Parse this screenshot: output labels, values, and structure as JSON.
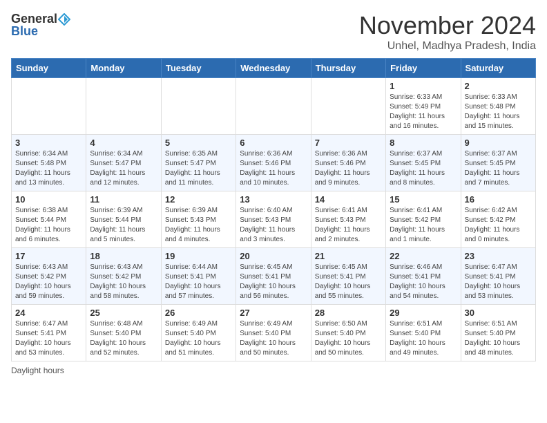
{
  "logo": {
    "general": "General",
    "blue": "Blue"
  },
  "title": "November 2024",
  "subtitle": "Unhel, Madhya Pradesh, India",
  "days_of_week": [
    "Sunday",
    "Monday",
    "Tuesday",
    "Wednesday",
    "Thursday",
    "Friday",
    "Saturday"
  ],
  "footer": "Daylight hours",
  "weeks": [
    [
      {
        "day": "",
        "info": ""
      },
      {
        "day": "",
        "info": ""
      },
      {
        "day": "",
        "info": ""
      },
      {
        "day": "",
        "info": ""
      },
      {
        "day": "",
        "info": ""
      },
      {
        "day": "1",
        "info": "Sunrise: 6:33 AM\nSunset: 5:49 PM\nDaylight: 11 hours and 16 minutes."
      },
      {
        "day": "2",
        "info": "Sunrise: 6:33 AM\nSunset: 5:48 PM\nDaylight: 11 hours and 15 minutes."
      }
    ],
    [
      {
        "day": "3",
        "info": "Sunrise: 6:34 AM\nSunset: 5:48 PM\nDaylight: 11 hours and 13 minutes."
      },
      {
        "day": "4",
        "info": "Sunrise: 6:34 AM\nSunset: 5:47 PM\nDaylight: 11 hours and 12 minutes."
      },
      {
        "day": "5",
        "info": "Sunrise: 6:35 AM\nSunset: 5:47 PM\nDaylight: 11 hours and 11 minutes."
      },
      {
        "day": "6",
        "info": "Sunrise: 6:36 AM\nSunset: 5:46 PM\nDaylight: 11 hours and 10 minutes."
      },
      {
        "day": "7",
        "info": "Sunrise: 6:36 AM\nSunset: 5:46 PM\nDaylight: 11 hours and 9 minutes."
      },
      {
        "day": "8",
        "info": "Sunrise: 6:37 AM\nSunset: 5:45 PM\nDaylight: 11 hours and 8 minutes."
      },
      {
        "day": "9",
        "info": "Sunrise: 6:37 AM\nSunset: 5:45 PM\nDaylight: 11 hours and 7 minutes."
      }
    ],
    [
      {
        "day": "10",
        "info": "Sunrise: 6:38 AM\nSunset: 5:44 PM\nDaylight: 11 hours and 6 minutes."
      },
      {
        "day": "11",
        "info": "Sunrise: 6:39 AM\nSunset: 5:44 PM\nDaylight: 11 hours and 5 minutes."
      },
      {
        "day": "12",
        "info": "Sunrise: 6:39 AM\nSunset: 5:43 PM\nDaylight: 11 hours and 4 minutes."
      },
      {
        "day": "13",
        "info": "Sunrise: 6:40 AM\nSunset: 5:43 PM\nDaylight: 11 hours and 3 minutes."
      },
      {
        "day": "14",
        "info": "Sunrise: 6:41 AM\nSunset: 5:43 PM\nDaylight: 11 hours and 2 minutes."
      },
      {
        "day": "15",
        "info": "Sunrise: 6:41 AM\nSunset: 5:42 PM\nDaylight: 11 hours and 1 minute."
      },
      {
        "day": "16",
        "info": "Sunrise: 6:42 AM\nSunset: 5:42 PM\nDaylight: 11 hours and 0 minutes."
      }
    ],
    [
      {
        "day": "17",
        "info": "Sunrise: 6:43 AM\nSunset: 5:42 PM\nDaylight: 10 hours and 59 minutes."
      },
      {
        "day": "18",
        "info": "Sunrise: 6:43 AM\nSunset: 5:42 PM\nDaylight: 10 hours and 58 minutes."
      },
      {
        "day": "19",
        "info": "Sunrise: 6:44 AM\nSunset: 5:41 PM\nDaylight: 10 hours and 57 minutes."
      },
      {
        "day": "20",
        "info": "Sunrise: 6:45 AM\nSunset: 5:41 PM\nDaylight: 10 hours and 56 minutes."
      },
      {
        "day": "21",
        "info": "Sunrise: 6:45 AM\nSunset: 5:41 PM\nDaylight: 10 hours and 55 minutes."
      },
      {
        "day": "22",
        "info": "Sunrise: 6:46 AM\nSunset: 5:41 PM\nDaylight: 10 hours and 54 minutes."
      },
      {
        "day": "23",
        "info": "Sunrise: 6:47 AM\nSunset: 5:41 PM\nDaylight: 10 hours and 53 minutes."
      }
    ],
    [
      {
        "day": "24",
        "info": "Sunrise: 6:47 AM\nSunset: 5:41 PM\nDaylight: 10 hours and 53 minutes."
      },
      {
        "day": "25",
        "info": "Sunrise: 6:48 AM\nSunset: 5:40 PM\nDaylight: 10 hours and 52 minutes."
      },
      {
        "day": "26",
        "info": "Sunrise: 6:49 AM\nSunset: 5:40 PM\nDaylight: 10 hours and 51 minutes."
      },
      {
        "day": "27",
        "info": "Sunrise: 6:49 AM\nSunset: 5:40 PM\nDaylight: 10 hours and 50 minutes."
      },
      {
        "day": "28",
        "info": "Sunrise: 6:50 AM\nSunset: 5:40 PM\nDaylight: 10 hours and 50 minutes."
      },
      {
        "day": "29",
        "info": "Sunrise: 6:51 AM\nSunset: 5:40 PM\nDaylight: 10 hours and 49 minutes."
      },
      {
        "day": "30",
        "info": "Sunrise: 6:51 AM\nSunset: 5:40 PM\nDaylight: 10 hours and 48 minutes."
      }
    ]
  ]
}
